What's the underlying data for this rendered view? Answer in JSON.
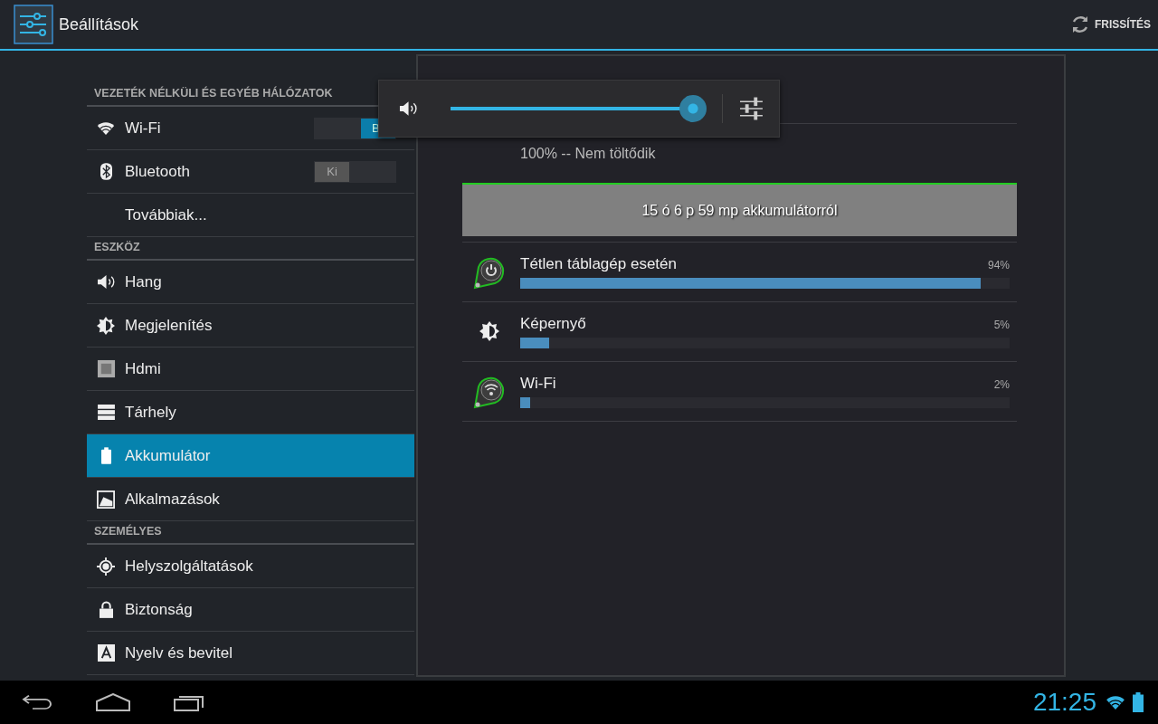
{
  "action_bar": {
    "title": "Beállítások",
    "refresh_button": "FRISSÍTÉS"
  },
  "sidebar": {
    "sections": [
      {
        "header": "VEZETÉK NÉLKÜLI ÉS EGYÉB HÁLÓZATOK",
        "items": [
          {
            "label": "Wi-Fi",
            "selected": false,
            "toggle": {
              "label": "B",
              "on": true
            }
          },
          {
            "label": "Bluetooth",
            "selected": false,
            "toggle": {
              "label": "Ki",
              "on": false
            }
          },
          {
            "label": "Továbbiak...",
            "selected": false
          }
        ]
      },
      {
        "header": "ESZKÖZ",
        "items": [
          {
            "label": "Hang",
            "selected": false
          },
          {
            "label": "Megjelenítés",
            "selected": false
          },
          {
            "label": "Hdmi",
            "selected": false
          },
          {
            "label": "Tárhely",
            "selected": false
          },
          {
            "label": "Akkumulátor",
            "selected": true
          },
          {
            "label": "Alkalmazások",
            "selected": false
          }
        ]
      },
      {
        "header": "SZEMÉLYES",
        "items": [
          {
            "label": "Helyszolgáltatások",
            "selected": false
          },
          {
            "label": "Biztonság",
            "selected": false
          },
          {
            "label": "Nyelv és bevitel",
            "selected": false
          }
        ]
      }
    ]
  },
  "battery": {
    "status": "100% -- Nem töltődik",
    "graph_label": "15 ó 6 p 59 mp akkumulátorról",
    "usage": [
      {
        "label": "Tétlen táblagép esetén",
        "percent": "94%",
        "level": 0.94
      },
      {
        "label": "Képernyő",
        "percent": "5%",
        "level": 0.06
      },
      {
        "label": "Wi-Fi",
        "percent": "2%",
        "level": 0.02
      }
    ]
  },
  "volume_popup": {
    "level": 1
  },
  "nav_bar": {
    "clock": "21:25"
  }
}
